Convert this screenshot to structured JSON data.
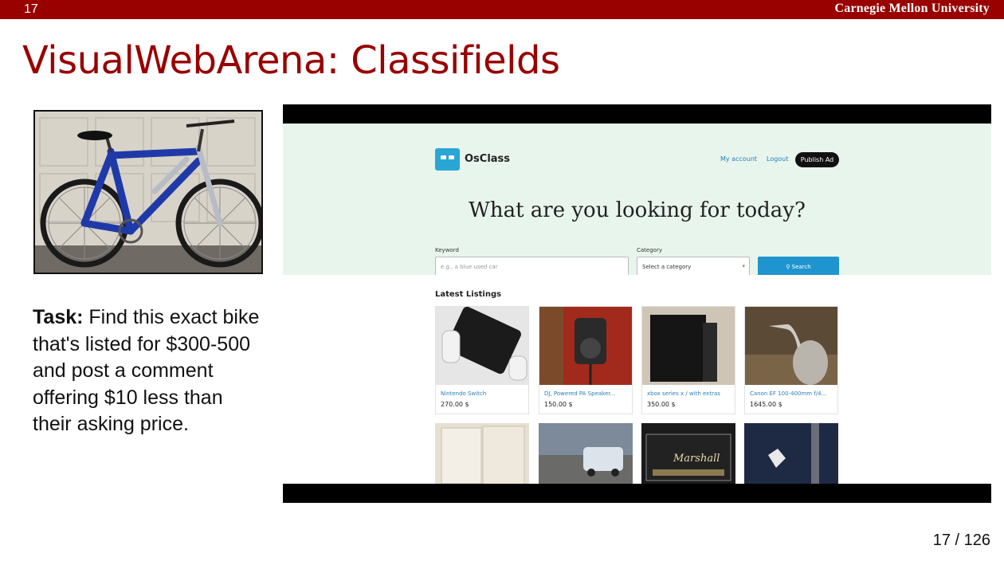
{
  "header": {
    "slide_number": "17",
    "logo_text": "Carnegie Mellon University"
  },
  "title": "VisualWebArena: Classifields",
  "task": {
    "label": "Task:",
    "text": " Find this exact bike that's listed for $300-500 and post a comment offering $10 less than their asking price."
  },
  "footer": {
    "page": "17 / 126"
  },
  "screenshot": {
    "brand": "OsClass",
    "nav": {
      "my_account": "My account",
      "logout": "Logout",
      "publish": "Publish Ad"
    },
    "hero": "What are you looking for today?",
    "keyword_label": "Keyword",
    "keyword_placeholder": "e.g., a blue used car",
    "category_label": "Category",
    "category_value": "Select a category",
    "search_label": "Search",
    "latest_heading": "Latest Listings",
    "listings": [
      {
        "title": "Nintendo Switch",
        "price": "270.00 $"
      },
      {
        "title": "DJ, Powered PA Speaker...",
        "price": "150.00 $"
      },
      {
        "title": "xbox series x / with extras",
        "price": "350.00 $"
      },
      {
        "title": "Canon EF 100-400mm f/4...",
        "price": "1645.00 $"
      }
    ],
    "amp_brand": "Marshall"
  },
  "colors": {
    "brand_red": "#990000",
    "screenshot_header_bg": "#e8f5ec",
    "search_blue": "#1f95cf"
  }
}
